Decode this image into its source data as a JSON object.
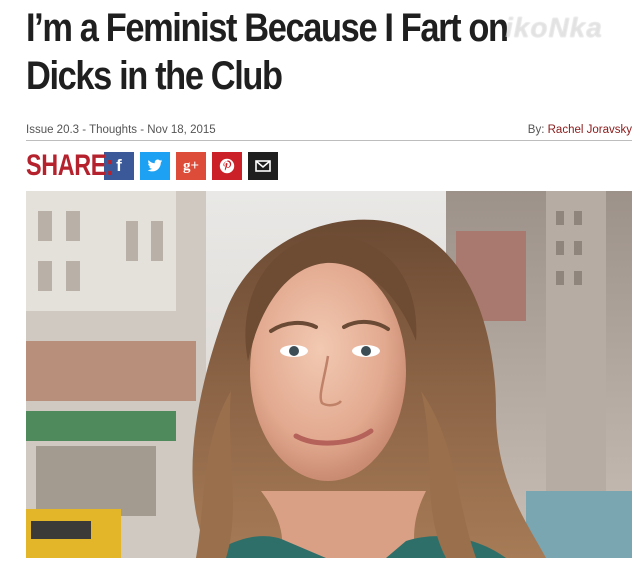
{
  "article": {
    "title": "I’m a Feminist Because I Fart on Dicks in the Club",
    "meta": "Issue 20.3 - Thoughts - Nov 18, 2015",
    "byline_prefix": "By:",
    "author": "Rachel Joravsky"
  },
  "watermark": "ikoNka",
  "share": {
    "label": "SHARE:",
    "buttons": [
      {
        "name": "facebook",
        "glyph": "f",
        "color": "#3b5998"
      },
      {
        "name": "twitter",
        "glyph": "t",
        "color": "#1da1f2"
      },
      {
        "name": "google-plus",
        "glyph": "g+",
        "color": "#dd4b39"
      },
      {
        "name": "pinterest",
        "glyph": "p",
        "color": "#cb2027"
      },
      {
        "name": "email",
        "glyph": "envelope",
        "color": "#1f1f1f"
      }
    ]
  }
}
